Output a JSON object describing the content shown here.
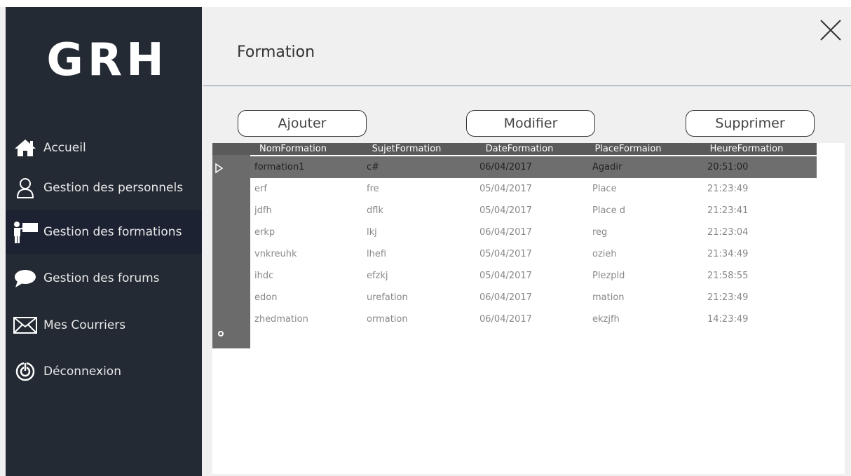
{
  "app": {
    "logo_text": "GRH"
  },
  "sidebar": {
    "items": [
      {
        "label": "Accueil",
        "icon": "home-icon"
      },
      {
        "label": "Gestion des personnels",
        "icon": "user-icon"
      },
      {
        "label": "Gestion des formations",
        "icon": "presenter-icon",
        "active": true
      },
      {
        "label": "Gestion des forums",
        "icon": "chat-icon"
      },
      {
        "label": "Mes Courriers",
        "icon": "envelope-icon"
      },
      {
        "label": "Déconnexion",
        "icon": "power-icon"
      }
    ]
  },
  "main": {
    "title": "Formation",
    "close_icon": "close-icon",
    "buttons": {
      "add": "Ajouter",
      "edit": "Modifier",
      "delete": "Supprimer"
    }
  },
  "grid": {
    "columns": [
      "NomFormation",
      "SujetFormation",
      "DateFormation",
      "PlaceFormaion",
      "HeureFormation"
    ],
    "rows": [
      [
        "formation1",
        "c#",
        "06/04/2017",
        "Agadir",
        "20:51:00"
      ],
      [
        "erf",
        "fre",
        "05/04/2017",
        "Place",
        "21:23:49"
      ],
      [
        "jdfh",
        "dflk",
        "05/04/2017",
        "Place d",
        "21:23:41"
      ],
      [
        "erkp",
        "lkj",
        "06/04/2017",
        "reg",
        "21:23:04"
      ],
      [
        "vnkreuhk",
        "lhefi",
        "05/04/2017",
        "ozieh",
        "21:34:49"
      ],
      [
        "ihdc",
        "efzkj",
        "05/04/2017",
        "Plezpld",
        "21:58:55"
      ],
      [
        "edon",
        "urefation",
        "06/04/2017",
        "mation",
        "21:23:49"
      ],
      [
        "zhedmation",
        "ormation",
        "06/04/2017",
        "ekzjfh",
        "14:23:49"
      ]
    ],
    "selected_row": 0,
    "colors": {
      "header": "#5a5a5a",
      "row_header": "#6b6b6b",
      "selected": "#6e6e6e"
    }
  },
  "colors": {
    "sidebar": "#232a33",
    "sidebar_active": "#1c2232",
    "main_bg": "#f0f0f0"
  }
}
